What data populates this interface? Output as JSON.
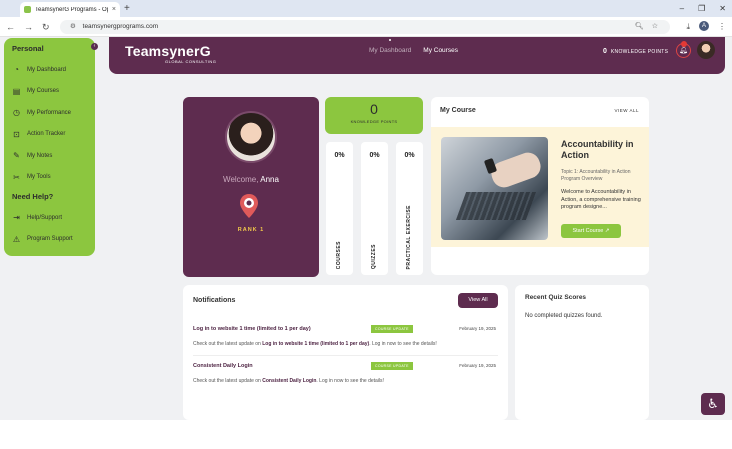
{
  "browser": {
    "tab_title": "TeamsynerG Programs - Optim",
    "tab_close": "×",
    "new_tab": "+",
    "url": "teamsynergprograms.com",
    "window_controls": [
      "–",
      "❐",
      "✕"
    ]
  },
  "sidebar": {
    "section_personal": "Personal",
    "personal_items": [
      {
        "label": "My Dashboard",
        "icon": "dashboard-icon"
      },
      {
        "label": "My Courses",
        "icon": "book-icon"
      },
      {
        "label": "My Performance",
        "icon": "performance-icon"
      },
      {
        "label": "Action Tracker",
        "icon": "tracker-icon"
      },
      {
        "label": "My Notes",
        "icon": "notes-icon"
      },
      {
        "label": "My Tools",
        "icon": "tools-icon"
      }
    ],
    "section_help": "Need Help?",
    "help_items": [
      {
        "label": "Help/Support",
        "icon": "support-icon"
      },
      {
        "label": "Program Support",
        "icon": "warning-icon"
      }
    ]
  },
  "header": {
    "logo": "TeamsynerG",
    "logo_sub": "GLOBAL CONSULTING",
    "nav": [
      "My Dashboard",
      "My Courses"
    ],
    "knowledge_points_value": "0",
    "knowledge_points_label": "KNOWLEDGE POINTS"
  },
  "profile": {
    "welcome": "Welcome,",
    "name": "Anna",
    "rank": "RANK 1"
  },
  "knowledge": {
    "value": "0",
    "label": "KNOWLEDGE POINTS"
  },
  "stats": [
    {
      "pct": "0%",
      "label": "COURSES"
    },
    {
      "pct": "0%",
      "label": "QUIZZES"
    },
    {
      "pct": "0%",
      "label": "PRACTICAL EXERCISE"
    }
  ],
  "my_course": {
    "title": "My Course",
    "view_all": "VIEW ALL",
    "course_name": "Accountability in Action",
    "topic": "Topic 1: Accountability in Action Program Overview",
    "description": "Welcome to Accountability in Action, a comprehensive training program designe...",
    "start_label": "Start Course",
    "start_icon": "↗"
  },
  "notifications": {
    "title": "Notifications",
    "view_all": "View All",
    "items": [
      {
        "title": "Log in to website 1 time (limited to 1 per day)",
        "badge": "COURSE UPDATE",
        "date": "February 19, 2025",
        "msg_prefix": "Check out the latest update on ",
        "msg_link": "Log in to website 1 time (limited to 1 per day)",
        "msg_suffix": ". Log in now to see the details!"
      },
      {
        "title": "Consistent Daily Login",
        "badge": "COURSE UPDATE",
        "date": "February 19, 2025",
        "msg_prefix": "Check out the latest update on ",
        "msg_link": "Consistent Daily Login",
        "msg_suffix": ". Log in now to see the details!"
      }
    ]
  },
  "quiz": {
    "title": "Recent Quiz Scores",
    "empty": "No completed quizzes found."
  },
  "colors": {
    "brand_plum": "#5e2c4f",
    "brand_green": "#8cc63f",
    "course_bg": "#fdf4d9"
  }
}
